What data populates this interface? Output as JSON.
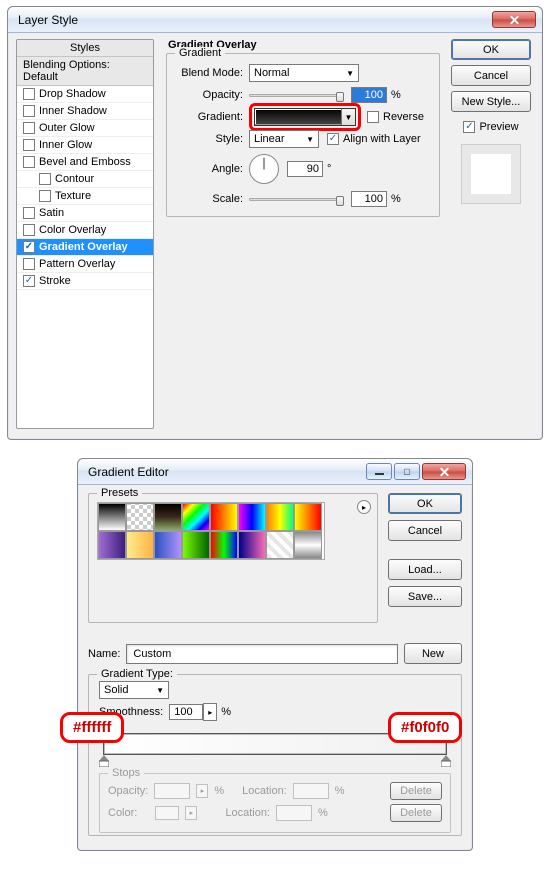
{
  "ls": {
    "title": "Layer Style",
    "styles_header": "Styles",
    "blending_sub": "Blending Options: Default",
    "options": [
      {
        "label": "Drop Shadow",
        "checked": false,
        "child": false
      },
      {
        "label": "Inner Shadow",
        "checked": false,
        "child": false
      },
      {
        "label": "Outer Glow",
        "checked": false,
        "child": false
      },
      {
        "label": "Inner Glow",
        "checked": false,
        "child": false
      },
      {
        "label": "Bevel and Emboss",
        "checked": false,
        "child": false
      },
      {
        "label": "Contour",
        "checked": false,
        "child": true
      },
      {
        "label": "Texture",
        "checked": false,
        "child": true
      },
      {
        "label": "Satin",
        "checked": false,
        "child": false
      },
      {
        "label": "Color Overlay",
        "checked": false,
        "child": false
      },
      {
        "label": "Gradient Overlay",
        "checked": true,
        "child": false,
        "selected": true
      },
      {
        "label": "Pattern Overlay",
        "checked": false,
        "child": false
      },
      {
        "label": "Stroke",
        "checked": true,
        "child": false
      }
    ],
    "group_title": "Gradient Overlay",
    "gradient_legend": "Gradient",
    "blend_mode_label": "Blend Mode:",
    "blend_mode_value": "Normal",
    "opacity_label": "Opacity:",
    "opacity_value": "100",
    "gradient_label": "Gradient:",
    "reverse_label": "Reverse",
    "style_label": "Style:",
    "style_value": "Linear",
    "align_label": "Align with Layer",
    "angle_label": "Angle:",
    "angle_value": "90",
    "degree": "°",
    "scale_label": "Scale:",
    "scale_value": "100",
    "pct": "%",
    "ok": "OK",
    "cancel": "Cancel",
    "new_style": "New Style...",
    "preview": "Preview"
  },
  "ge": {
    "title": "Gradient Editor",
    "presets_legend": "Presets",
    "ok": "OK",
    "cancel": "Cancel",
    "load": "Load...",
    "save": "Save...",
    "name_label": "Name:",
    "name_value": "Custom",
    "new": "New",
    "type_label": "Gradient Type:",
    "type_value": "Solid",
    "smooth_label": "Smoothness:",
    "smooth_value": "100",
    "pct": "%",
    "stops_legend": "Stops",
    "opacity_lbl": "Opacity:",
    "location_lbl": "Location:",
    "color_lbl": "Color:",
    "delete": "Delete",
    "presets": [
      "linear-gradient(#000,#fff)",
      "repeating-conic-gradient(#ccc 0 25%,#fff 0 50%) 0/8px 8px",
      "linear-gradient(#000,#3a2a1a,#8a6)",
      "linear-gradient(135deg,#f00,#ff0,#0f0,#0ff,#00f,#f0f)",
      "linear-gradient(90deg,#f00,#ff0)",
      "linear-gradient(90deg,#f0f,#00f,#0ff)",
      "linear-gradient(90deg,#ff7f00,#ffff00,#00ff7f)",
      "linear-gradient(90deg,#ff0,#f00)",
      "linear-gradient(90deg,#a06cd5,#3b1f7a)",
      "linear-gradient(90deg,#ffec8b,#ffb347)",
      "linear-gradient(90deg,#2a52be,#b094ff)",
      "linear-gradient(90deg,#7cfc00,#006400)",
      "linear-gradient(90deg,#ff0000,#00ff00,#0000ff)",
      "linear-gradient(90deg,#00008b,#ff69b4)",
      "repeating-linear-gradient(45deg,#e6e6e6 0 4px,#fff 4px 8px)",
      "linear-gradient(#888,#fff,#888)"
    ]
  },
  "callouts": {
    "left": "#ffffff",
    "right": "#f0f0f0"
  }
}
